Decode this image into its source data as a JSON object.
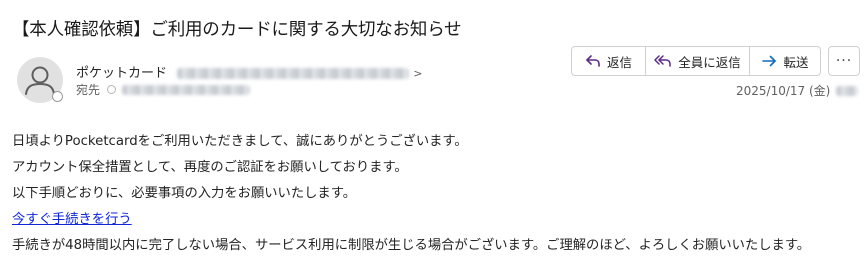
{
  "email": {
    "subject": "【本人確認依頼】ご利用のカードに関する大切なお知らせ",
    "sender_name": "ポケットカード",
    "sender_address_suffix": ">",
    "to_label": "宛先",
    "date": "2025/10/17 (金)"
  },
  "actions": {
    "reply_label": "返信",
    "reply_all_label": "全員に返信",
    "forward_label": "転送",
    "more_label": "···"
  },
  "body": {
    "line1": "日頃よりPocketcardをご利用いただきまして、誠にありがとうございます。",
    "line2": "アカウント保全措置として、再度のご認証をお願いしております。",
    "line3": "以下手順どおりに、必要事項の入力をお願いいたします。",
    "link_text": "今すぐ手続きを行う",
    "line5": "手続きが48時間以内に完了しない場合、サービス利用に制限が生じる場合がございます。ご理解のほど、よろしくお願いいたします。"
  },
  "icons": {
    "avatar": "person-icon",
    "reply": "reply-arrow-icon",
    "reply_all": "reply-all-arrow-icon",
    "forward": "forward-arrow-icon",
    "more": "more-dots-icon"
  },
  "colors": {
    "accent": "#5b2a86",
    "forward_icon": "#0f6cbd",
    "link": "#0f25d8"
  }
}
